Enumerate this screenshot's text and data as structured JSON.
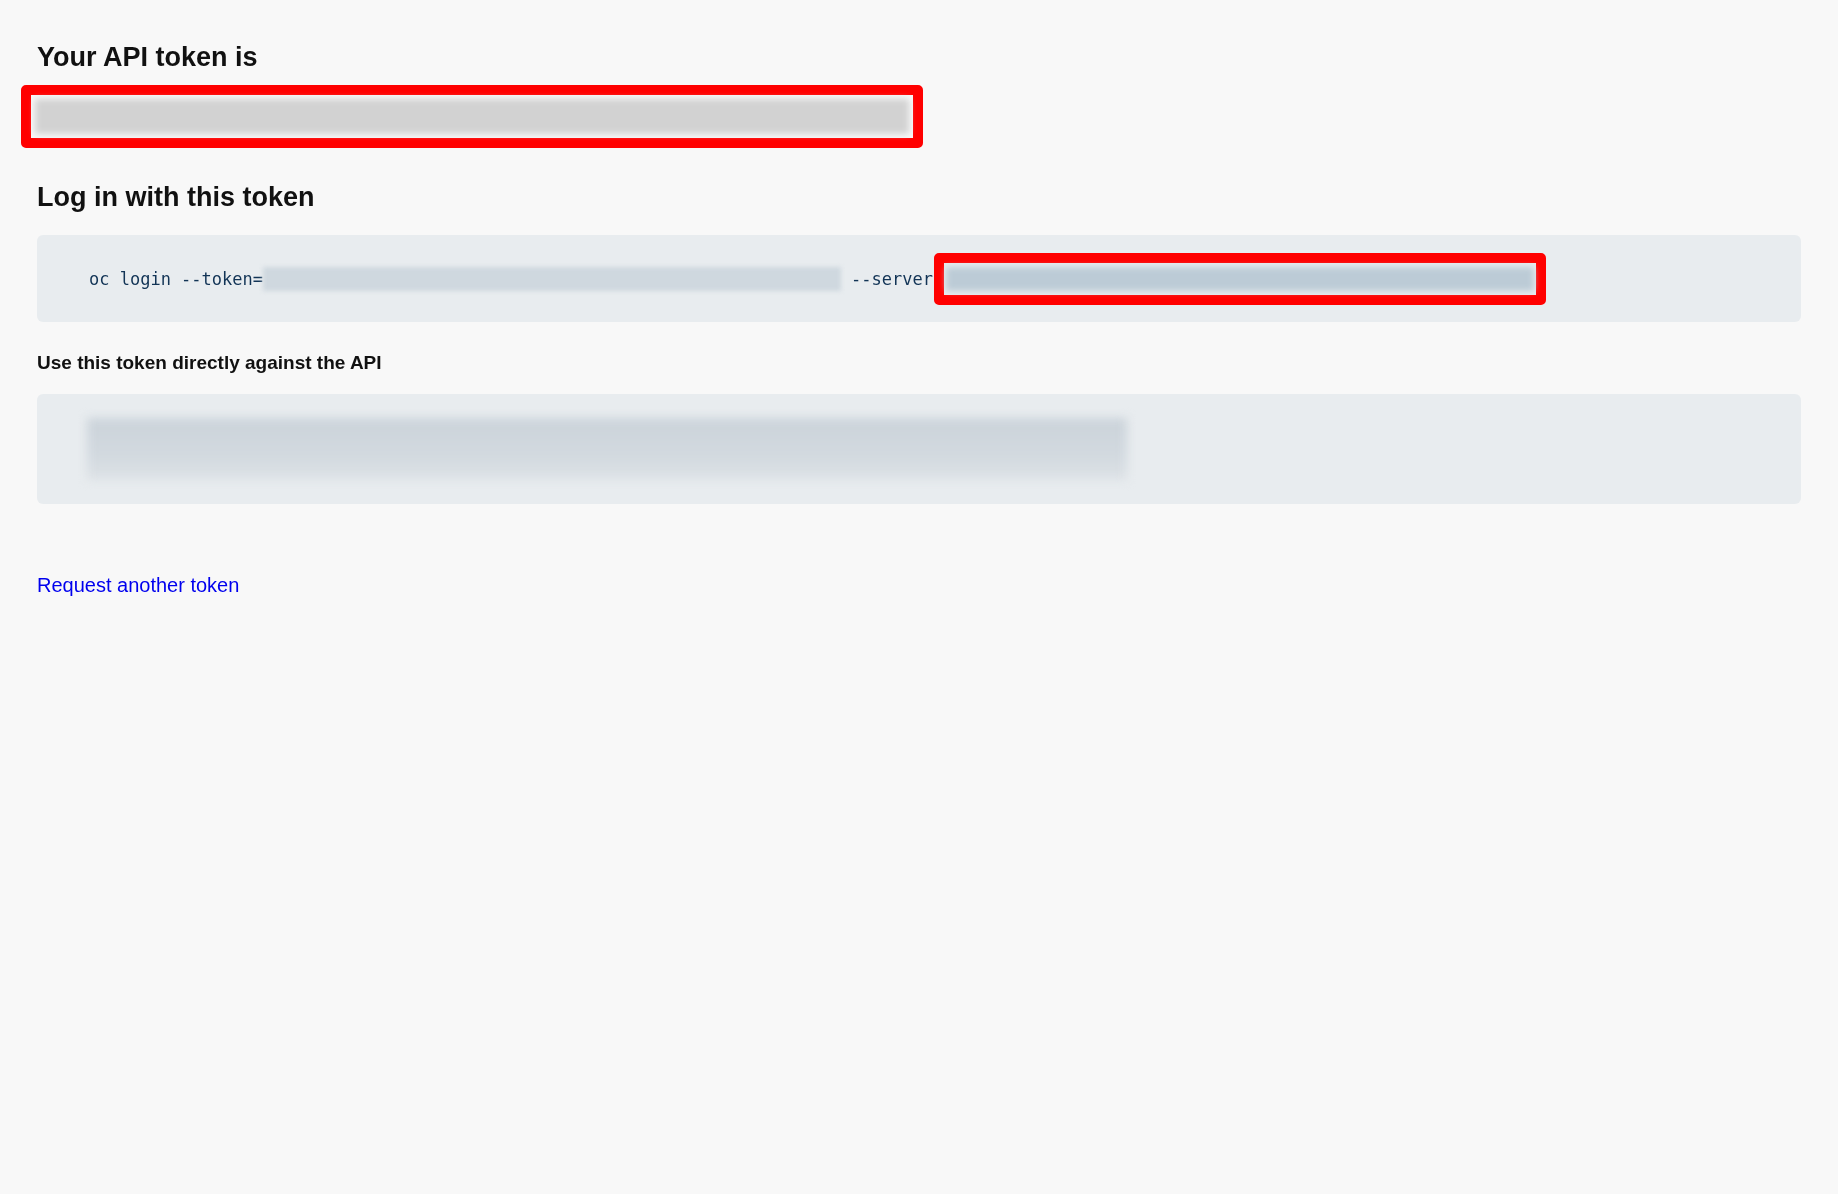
{
  "token_section": {
    "heading": "Your API token is",
    "token": {
      "redacted": true,
      "highlighted": true
    }
  },
  "login_section": {
    "heading": "Log in with this token",
    "command": {
      "prefix": "oc login --token=",
      "token_redacted": true,
      "server_flag": "--server",
      "server_redacted": true,
      "server_highlighted": true
    }
  },
  "api_section": {
    "heading": "Use this token directly against the API",
    "command_redacted": true
  },
  "link": {
    "label": "Request another token"
  }
}
